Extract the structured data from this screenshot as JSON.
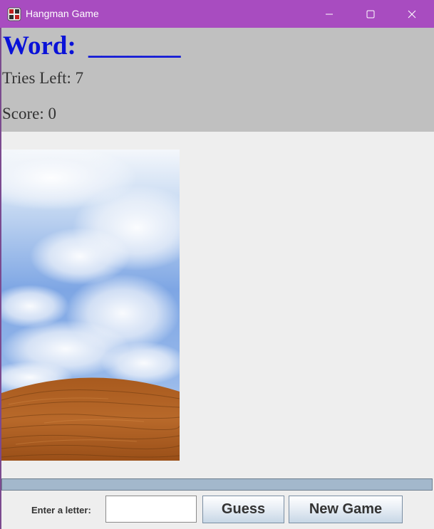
{
  "window": {
    "title": "Hangman Game",
    "icons": {
      "app": "hangman-app-icon",
      "minimize": "minimize-icon",
      "maximize": "maximize-icon",
      "close": "close-icon"
    },
    "colors": {
      "titlebar": "#a84cc0",
      "header_panel": "#c0c0c0",
      "word_text": "#0a12d8",
      "body_background": "#eeeeee"
    }
  },
  "header": {
    "word_label": "Word:",
    "word_blanks": "_______",
    "tries_left": "Tries Left: 7",
    "score": "Score: 0"
  },
  "controls": {
    "letter_label": "Enter a letter:",
    "letter_value": "",
    "guess_label": "Guess",
    "new_game_label": "New Game"
  }
}
